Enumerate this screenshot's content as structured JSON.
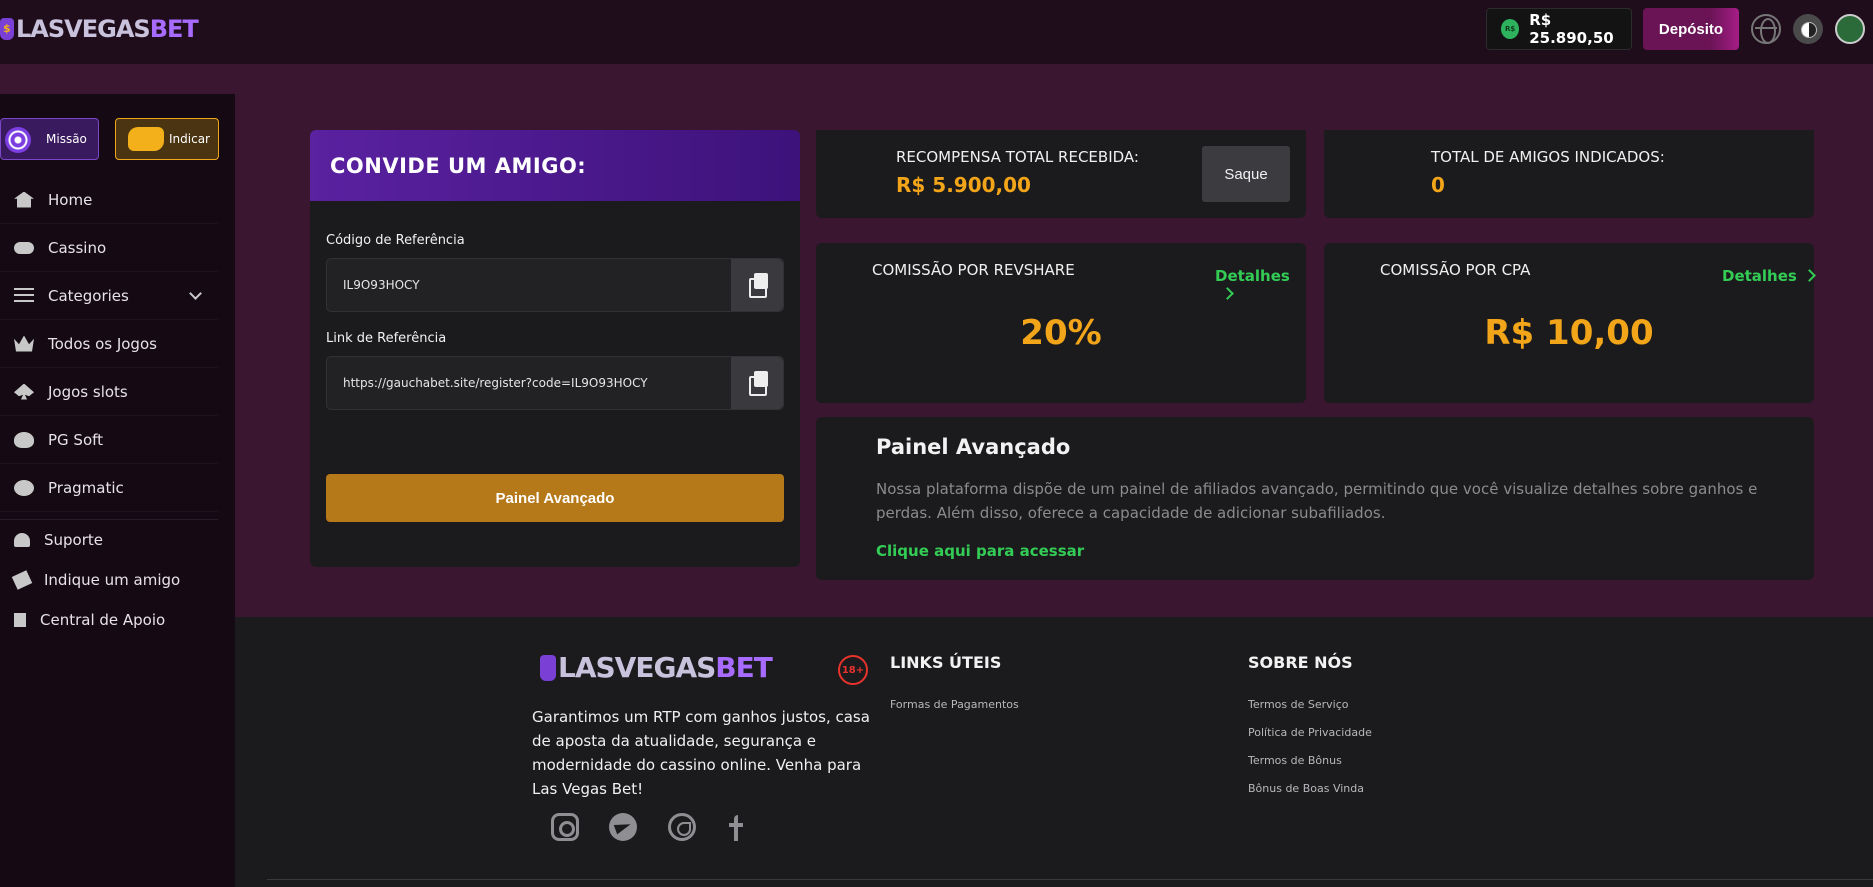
{
  "header": {
    "logo_main": "LASVEGAS",
    "logo_accent": "BET",
    "balance_symbol": "R$",
    "balance": "R$ 25.890,50",
    "deposit_label": "Depósito"
  },
  "sidebar": {
    "missao_label": "Missão",
    "indicar_label": "Indicar",
    "items": [
      {
        "label": "Home",
        "icon": "home-icon"
      },
      {
        "label": "Cassino",
        "icon": "gamepad-icon"
      },
      {
        "label": "Categories",
        "icon": "list-icon"
      },
      {
        "label": "Todos os Jogos",
        "icon": "crown-icon"
      },
      {
        "label": "Jogos slots",
        "icon": "spade-icon"
      },
      {
        "label": "PG Soft",
        "icon": "paw-icon"
      },
      {
        "label": "Pragmatic",
        "icon": "pragmatic-icon"
      }
    ],
    "support_items": [
      {
        "label": "Suporte",
        "icon": "headset-icon"
      },
      {
        "label": "Indique um amigo",
        "icon": "ticket-icon"
      },
      {
        "label": "Central de Apoio",
        "icon": "document-icon"
      }
    ]
  },
  "invite": {
    "title": "CONVIDE UM AMIGO:",
    "code_label": "Código de Referência",
    "code_value": "IL9O93HOCY",
    "link_label": "Link de Referência",
    "link_value": "https://gauchabet.site/register?code=IL9O93HOCY",
    "button_label": "Painel Avançado"
  },
  "stats": {
    "reward_label": "RECOMPENSA TOTAL RECEBIDA:",
    "reward_value": "R$ 5.900,00",
    "saque_label": "Saque",
    "friends_label": "TOTAL DE AMIGOS INDICADOS:",
    "friends_value": "0",
    "revshare_label": "COMISSÃO POR REVSHARE",
    "revshare_value": "20%",
    "cpa_label": "COMISSÃO POR CPA",
    "cpa_value": "R$ 10,00",
    "details_label": "Detalhes"
  },
  "advanced": {
    "title": "Painel Avançado",
    "description": "Nossa plataforma dispõe de um painel de afiliados avançado, permitindo que você visualize detalhes sobre ganhos e perdas. Além disso, oferece a capacidade de adicionar subafiliados.",
    "link": "Clique aqui para acessar"
  },
  "footer": {
    "age_badge": "18+",
    "description": "Garantimos um RTP com ganhos justos, casa de aposta da atualidade, segurança e modernidade do cassino online. Venha para Las Vegas Bet!",
    "links_title": "LINKS ÚTEIS",
    "links": [
      "Formas de Pagamentos"
    ],
    "about_title": "SOBRE NÓS",
    "about_links": [
      "Termos de Serviço",
      "Política de Privacidade",
      "Termos de Bônus",
      "Bônus de Boas Vinda"
    ]
  },
  "colors": {
    "accent_gold": "#f3a51a",
    "accent_green": "#33cc55",
    "accent_purple": "#5a21a0",
    "background": "#3a1630"
  }
}
